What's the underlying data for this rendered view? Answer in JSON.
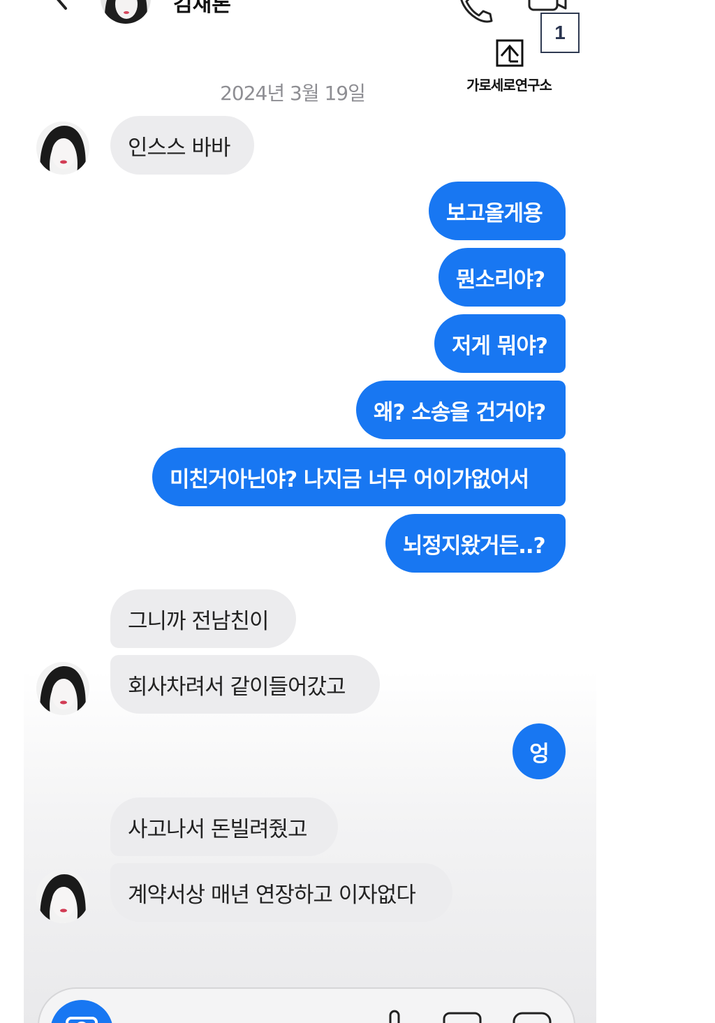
{
  "header": {
    "contact_name": "김재론",
    "notification_count": "1"
  },
  "watermark": {
    "text": "가로세로연구소"
  },
  "chat": {
    "date": "2024년 3월 19일",
    "messages": [
      {
        "side": "in",
        "text": "인스스 바바"
      },
      {
        "side": "out",
        "text": "보고올게용"
      },
      {
        "side": "out",
        "text": "뭔소리야?"
      },
      {
        "side": "out",
        "text": "저게 뭐야?"
      },
      {
        "side": "out",
        "text": "왜? 소송을 건거야?"
      },
      {
        "side": "out",
        "text": "미친거아닌야? 나지금 너무 어이가없어서"
      },
      {
        "side": "out",
        "text": "뇌정지왔거든..?"
      },
      {
        "side": "in",
        "text": "그니까 전남친이"
      },
      {
        "side": "in",
        "text": "회사차려서 같이들어갔고"
      },
      {
        "side": "out",
        "text": "엉"
      },
      {
        "side": "in",
        "text": "사고나서 돈빌려줬고"
      },
      {
        "side": "in",
        "text": "계약서상 매년 연장하고 이자없다"
      }
    ]
  },
  "icons": {
    "back": "chevron-left-icon",
    "call": "phone-icon",
    "video": "video-camera-icon",
    "camera": "camera-icon",
    "mic": "microphone-icon",
    "gallery": "image-icon",
    "sticker": "sticker-icon"
  },
  "colors": {
    "outgoing_bubble": "#1877f2",
    "incoming_bubble": "#ececee",
    "date_text": "#8e8e93",
    "badge_border": "#2f3a52"
  }
}
